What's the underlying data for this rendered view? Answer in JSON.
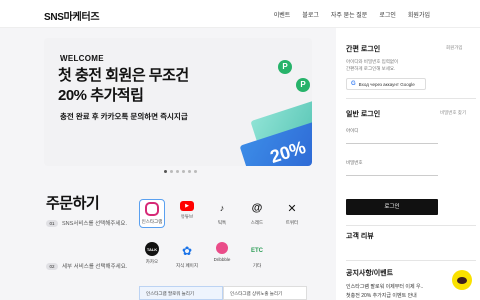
{
  "header": {
    "logo": "SNS마케터즈",
    "nav": [
      "이벤트",
      "블로그",
      "자주 묻는 질문",
      "로그인",
      "회원가입"
    ]
  },
  "banner": {
    "welcome": "WELCOME",
    "headline1": "첫 충전 회원은 무조건",
    "headline2": "20% 추가적립",
    "subtitle": "충전 완료 후 카카오톡 문의하면 즉시지급",
    "ticket_text": "20%",
    "coin_icon": "P",
    "slide_count": 6,
    "active_slide": 1
  },
  "order": {
    "title": "주문하기",
    "step1_num": "01",
    "step1_text": "SNS서비스를 선택해주세요.",
    "step2_num": "02",
    "step2_text": "세부 서비스를 선택해주세요.",
    "services": [
      {
        "label": "인스타그램",
        "icon": "instagram-icon",
        "color": "#d62976",
        "selected": true
      },
      {
        "label": "유튜브",
        "icon": "youtube-icon",
        "color": "#ff0000"
      },
      {
        "label": "틱톡",
        "icon": "tiktok-icon",
        "color": "#111111"
      },
      {
        "label": "스레드",
        "icon": "threads-icon",
        "color": "#111111"
      },
      {
        "label": "트위터",
        "icon": "x-icon",
        "color": "#111111"
      },
      {
        "label": "카카오",
        "icon": "kakao-talk-icon",
        "color": "#111111"
      },
      {
        "label": "지식 페이지",
        "icon": "gear-icon",
        "color": "#1a73e8"
      },
      {
        "label": "Dribbble",
        "icon": "dribbble-icon",
        "color": "#ea4c89"
      },
      {
        "label": "기타",
        "icon": "etc-icon",
        "color": "#2e9e58"
      }
    ],
    "sub_tabs": [
      "인스타그램 팔로워 늘리기",
      "인스타그램 상위노출 늘리기"
    ]
  },
  "sidebar": {
    "quick_login_title": "간편 로그인",
    "signup_link": "회원가입",
    "quick_desc_line1": "아이디와 비밀번호 입력없이",
    "quick_desc_line2": "간편하게 로그인해 보세요.",
    "google_button": "Вход через аккаунт Google",
    "normal_login_title": "일반 로그인",
    "find_password": "비밀번호 찾기",
    "id_label": "아이디",
    "password_label": "비밀번호",
    "login_button": "로그인",
    "reviews_title": "고객 리뷰",
    "notice_title": "공지사항/이벤트",
    "notice1": "인스타그램 팔로워 이제부터 이제 우..",
    "notice2": "첫충전 20% 추가지급 이벤트 안내"
  }
}
